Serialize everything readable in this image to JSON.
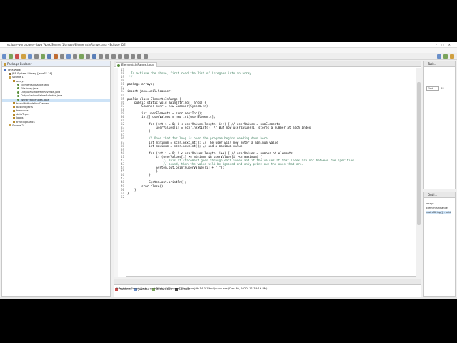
{
  "window": {
    "title": "eclipse-workspace - Java Work/Source 1/arrays/ElementsInRange.java - Eclipse IDE",
    "controls": "–□×"
  },
  "menu": [
    "File",
    "Edit",
    "Source",
    "Refactor",
    "Navigate",
    "Search",
    "Project",
    "Run",
    "Window",
    "Help"
  ],
  "package_explorer": {
    "title": "Package Explorer",
    "items": [
      {
        "label": "Java Work",
        "icon": "project-icon",
        "indent": 0
      },
      {
        "label": "JRE System Library [JavaSE-14]",
        "icon": "library-icon",
        "indent": 1
      },
      {
        "label": "Source 1",
        "icon": "source-folder-icon",
        "indent": 1
      },
      {
        "label": "arrays",
        "icon": "package-icon",
        "indent": 2
      },
      {
        "label": "ElementsInRange.java",
        "icon": "java-file-icon",
        "indent": 3
      },
      {
        "label": "FillsArray.java",
        "icon": "java-file-icon",
        "indent": 3
      },
      {
        "label": "OutputNumbersInReverse.java",
        "icon": "java-file-icon",
        "indent": 3
      },
      {
        "label": "OutputValuesBelowAnIndex.java",
        "icon": "java-file-icon",
        "indent": 3
      },
      {
        "label": "WordFrequencies.java",
        "icon": "java-file-icon",
        "indent": 3,
        "selected": true
      },
      {
        "label": "basicMethodsAndClasses",
        "icon": "package-icon",
        "indent": 2
      },
      {
        "label": "basicObjects",
        "icon": "package-icon",
        "indent": 2
      },
      {
        "label": "branches",
        "icon": "package-icon",
        "indent": 2
      },
      {
        "label": "dataTypes",
        "icon": "package-icon",
        "indent": 2
      },
      {
        "label": "loops",
        "icon": "package-icon",
        "indent": 2
      },
      {
        "label": "treatingBasics",
        "icon": "package-icon",
        "indent": 2
      },
      {
        "label": "Source 2",
        "icon": "source-folder-icon",
        "indent": 1
      }
    ]
  },
  "editor": {
    "tab_label": "ElementsInRange.java",
    "lines": [
      {
        "n": "17",
        "text": "",
        "style": ""
      },
      {
        "n": "18",
        "text": "  To achieve the above, first read the list of integers into an array.",
        "style": "cmt"
      },
      {
        "n": "19",
        "text": " */",
        "style": "cmt"
      },
      {
        "n": "20",
        "text": "",
        "style": ""
      },
      {
        "n": "21",
        "text": "package arrays;",
        "style": ""
      },
      {
        "n": "22",
        "text": "",
        "style": ""
      },
      {
        "n": "23",
        "text": "import java.util.Scanner;",
        "style": ""
      },
      {
        "n": "24",
        "text": "",
        "style": ""
      },
      {
        "n": "25",
        "text": "public class ElementsInRange {",
        "style": ""
      },
      {
        "n": "26",
        "text": "    public static void main(String[] args) {",
        "style": ""
      },
      {
        "n": "27",
        "text": "        Scanner scnr = new Scanner(System.in);",
        "style": ""
      },
      {
        "n": "28",
        "text": "",
        "style": ""
      },
      {
        "n": "29",
        "text": "        int userElements = scnr.nextInt();",
        "style": ""
      },
      {
        "n": "30",
        "text": "        int[] userValues = new int[userElements];",
        "style": ""
      },
      {
        "n": "31",
        "text": "",
        "style": ""
      },
      {
        "n": "32",
        "text": "            for (int i = 0; i < userValues.length; i++) { // userValues = numElements",
        "style": ""
      },
      {
        "n": "33",
        "text": "                userValues[i] = scnr.nextInt(); // But now userValues[i] stores a number at each index",
        "style": ""
      },
      {
        "n": "34",
        "text": "            }",
        "style": ""
      },
      {
        "n": "35",
        "text": "",
        "style": ""
      },
      {
        "n": "36",
        "text": "            // Once that for loop is over the program begins reading down here.",
        "style": "cmt"
      },
      {
        "n": "37",
        "text": "            int minimum = scnr.nextInt(); // The user will now enter a minimum value",
        "style": ""
      },
      {
        "n": "38",
        "text": "            int maximum = scnr.nextInt(); // and a maximum value.",
        "style": ""
      },
      {
        "n": "39",
        "text": "",
        "style": ""
      },
      {
        "n": "40",
        "text": "            for (int i = 0; i < userValues.length; i++) { // userValues = number of elements",
        "style": ""
      },
      {
        "n": "41",
        "text": "                if (userValues[i] >= minimum && userValues[i] <= maximum) {",
        "style": ""
      },
      {
        "n": "42",
        "text": "                    // This if statement goes through each index and if the values at that index are not between the specified",
        "style": "cmt"
      },
      {
        "n": "43",
        "text": "                    // bound, then the value will be ignored and only print out the ones that are.",
        "style": "cmt"
      },
      {
        "n": "44",
        "text": "                System.out.print(userValues[i] + \" \");",
        "style": ""
      },
      {
        "n": "45",
        "text": "                }",
        "style": ""
      },
      {
        "n": "46",
        "text": "            }",
        "style": ""
      },
      {
        "n": "47",
        "text": "",
        "style": ""
      },
      {
        "n": "48",
        "text": "            System.out.println();",
        "style": ""
      },
      {
        "n": "49",
        "text": "        scnr.close();",
        "style": ""
      },
      {
        "n": "50",
        "text": "    }",
        "style": ""
      },
      {
        "n": "51",
        "text": "}",
        "style": ""
      },
      {
        "n": "52",
        "text": "",
        "style": ""
      }
    ]
  },
  "bottom_panel": {
    "tabs": [
      "Problems",
      "Javadoc",
      "Declaration",
      "Console"
    ],
    "active_tab": "Console",
    "console_text": "ElementsInRange [Java Application] C:\\Program Files\\Java\\jdk-14.0.1\\bin\\javaw.exe (Dec 30, 2020, 11:33:16 PM)"
  },
  "task_panel": {
    "title": "Task...",
    "find_placeholder": "Find",
    "find_all": "All"
  },
  "outline_panel": {
    "title": "Outli...",
    "items": [
      "arrays",
      "ElementsInRange",
      "main(String[]) : void"
    ]
  },
  "colors": {
    "accent": "#4a72c4",
    "comment": "#3f7f5f",
    "selection": "#cde3f7"
  }
}
